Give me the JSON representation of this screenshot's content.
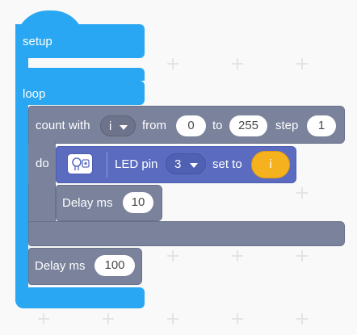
{
  "blocks": {
    "setup": {
      "label": "setup"
    },
    "loop": {
      "label": "loop"
    },
    "count_with": {
      "label": "count with",
      "variable": "i",
      "from_label": "from",
      "from_value": "0",
      "to_label": "to",
      "to_value": "255",
      "step_label": "step",
      "step_value": "1",
      "do_label": "do"
    },
    "led": {
      "label": "LED pin",
      "pin": "3",
      "set_to_label": "set to",
      "value_variable": "i",
      "icon": "led-icon"
    },
    "delay_inner": {
      "label": "Delay ms",
      "value": "10"
    },
    "delay_outer": {
      "label": "Delay ms",
      "value": "100"
    }
  },
  "colors": {
    "event_blue": "#2aa7f2",
    "control_slate": "#7a829c",
    "io_indigo": "#5b6cc0",
    "variable_orange": "#f6b21e"
  }
}
